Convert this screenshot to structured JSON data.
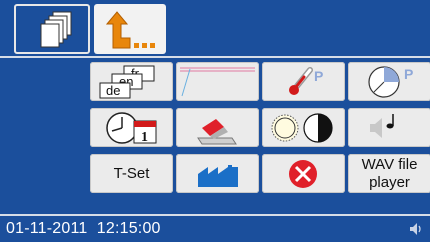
{
  "toolbar": {
    "pages_icon": "stacked-pages-icon",
    "home_icon": "up-arrow-ellipsis-icon"
  },
  "grid": {
    "language": {
      "labels": [
        "fr",
        "en",
        "de"
      ],
      "icon": "language-cards-icon"
    },
    "trend": {
      "icon": "trend-graph-icon"
    },
    "temperature": {
      "badge": "P",
      "icon": "thermometer-icon"
    },
    "timer": {
      "badge": "P",
      "icon": "pie-clock-icon"
    },
    "clock_date": {
      "calendar_day": "1",
      "icon": "clock-calendar-icon"
    },
    "cleaning": {
      "icon": "eraser-icon"
    },
    "display": {
      "icon": "brightness-contrast-icon"
    },
    "volume": {
      "icon": "speaker-note-icon"
    },
    "tset": {
      "label": "T-Set"
    },
    "factory": {
      "icon": "factory-icon"
    },
    "exit": {
      "icon": "red-x-icon"
    },
    "wav": {
      "label_line1": "WAV file",
      "label_line2": "player"
    }
  },
  "status_bar": {
    "date": "01-11-2011",
    "time": "12:15:00",
    "speaker_icon": "speaker-icon"
  },
  "colors": {
    "background": "#1b4f9c",
    "button": "#ebebeb",
    "accent_orange": "#e8860b",
    "accent_red": "#e0202a"
  }
}
